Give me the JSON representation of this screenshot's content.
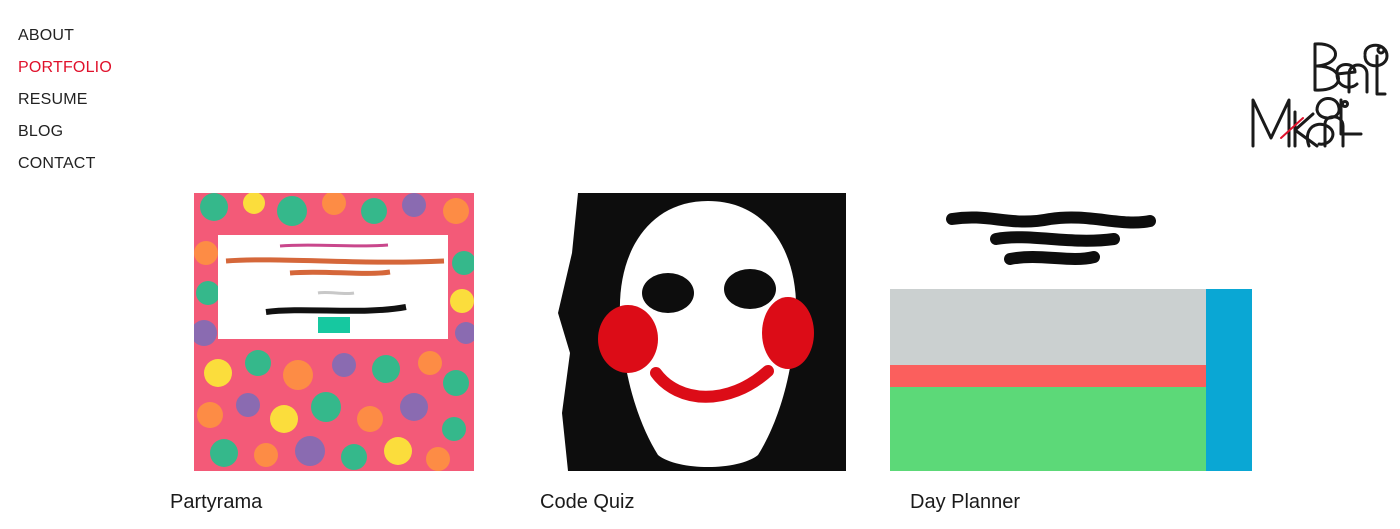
{
  "nav": {
    "items": [
      {
        "label": "ABOUT"
      },
      {
        "label": "PORTFOLIO"
      },
      {
        "label": "RESUME"
      },
      {
        "label": "BLOG"
      },
      {
        "label": "CONTACT"
      }
    ],
    "active_index": 1,
    "active_color": "#e0112b"
  },
  "logo": {
    "icon": "handwritten-signature-logo",
    "accent_color": "#e0112b"
  },
  "projects": [
    {
      "title": "Partyrama",
      "image": "colorful-confetti-painting"
    },
    {
      "title": "Code Quiz",
      "image": "jigsaw-puppet-face-painting"
    },
    {
      "title": "Day Planner",
      "image": "calendar-blocks-painting"
    }
  ]
}
